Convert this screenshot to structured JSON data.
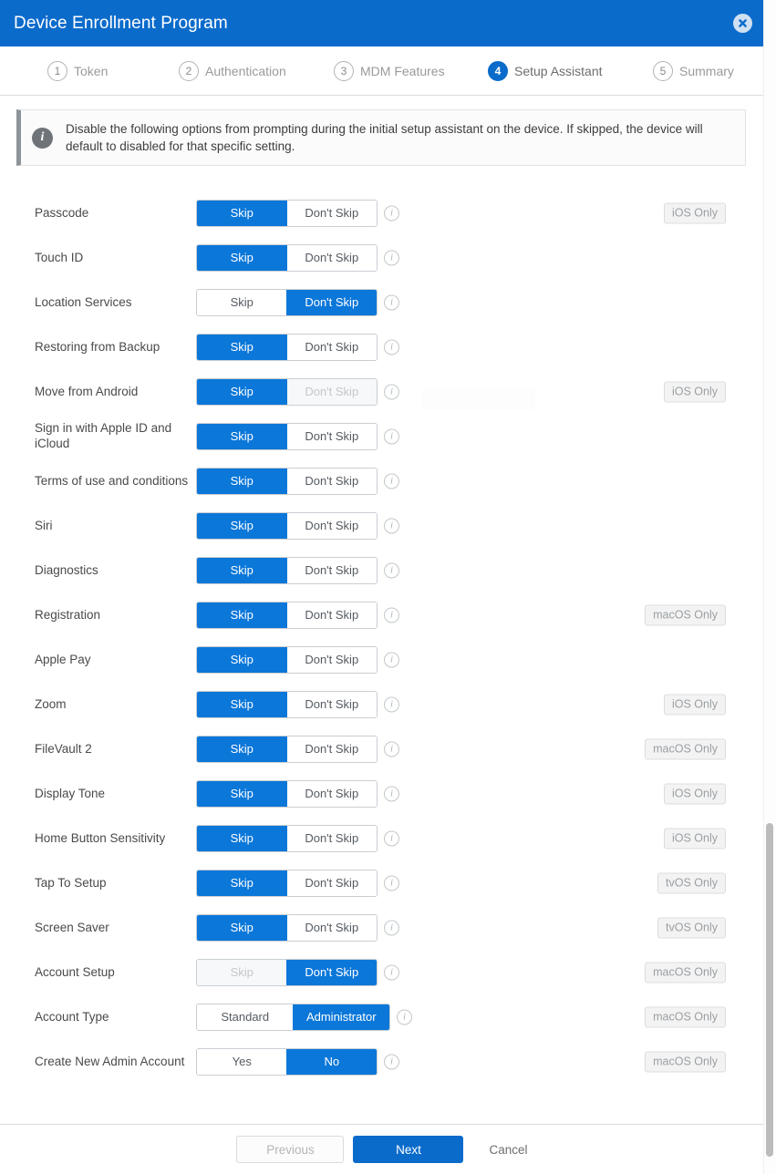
{
  "window": {
    "title": "Device Enrollment Program",
    "close_icon": "close-circle-icon",
    "accent_color": "#0b6bcb"
  },
  "stepper": {
    "steps": [
      {
        "number": "1",
        "label": "Token",
        "active": false
      },
      {
        "number": "2",
        "label": "Authentication",
        "active": false
      },
      {
        "number": "3",
        "label": "MDM Features",
        "active": false
      },
      {
        "number": "4",
        "label": "Setup Assistant",
        "active": true
      },
      {
        "number": "5",
        "label": "Summary",
        "active": false
      }
    ]
  },
  "banner": {
    "icon": "info-icon",
    "text": "Disable the following options from prompting during the initial setup assistant on the device. If skipped, the device will default to disabled for that specific setting."
  },
  "options": [
    {
      "label": "Passcode",
      "left": "Skip",
      "right": "Don't Skip",
      "selected": "left",
      "disabled": "",
      "badge": "iOS Only"
    },
    {
      "label": "Touch ID",
      "left": "Skip",
      "right": "Don't Skip",
      "selected": "left",
      "disabled": "",
      "badge": ""
    },
    {
      "label": "Location Services",
      "left": "Skip",
      "right": "Don't Skip",
      "selected": "right",
      "disabled": "",
      "badge": ""
    },
    {
      "label": "Restoring from Backup",
      "left": "Skip",
      "right": "Don't Skip",
      "selected": "left",
      "disabled": "",
      "badge": ""
    },
    {
      "label": "Move from Android",
      "left": "Skip",
      "right": "Don't Skip",
      "selected": "left",
      "disabled": "right",
      "badge": "iOS Only"
    },
    {
      "label": "Sign in with Apple ID and iCloud",
      "left": "Skip",
      "right": "Don't Skip",
      "selected": "left",
      "disabled": "",
      "badge": ""
    },
    {
      "label": "Terms of use and conditions",
      "left": "Skip",
      "right": "Don't Skip",
      "selected": "left",
      "disabled": "",
      "badge": ""
    },
    {
      "label": "Siri",
      "left": "Skip",
      "right": "Don't Skip",
      "selected": "left",
      "disabled": "",
      "badge": ""
    },
    {
      "label": "Diagnostics",
      "left": "Skip",
      "right": "Don't Skip",
      "selected": "left",
      "disabled": "",
      "badge": ""
    },
    {
      "label": "Registration",
      "left": "Skip",
      "right": "Don't Skip",
      "selected": "left",
      "disabled": "",
      "badge": "macOS Only"
    },
    {
      "label": "Apple Pay",
      "left": "Skip",
      "right": "Don't Skip",
      "selected": "left",
      "disabled": "",
      "badge": ""
    },
    {
      "label": "Zoom",
      "left": "Skip",
      "right": "Don't Skip",
      "selected": "left",
      "disabled": "",
      "badge": "iOS Only"
    },
    {
      "label": "FileVault 2",
      "left": "Skip",
      "right": "Don't Skip",
      "selected": "left",
      "disabled": "",
      "badge": "macOS Only"
    },
    {
      "label": "Display Tone",
      "left": "Skip",
      "right": "Don't Skip",
      "selected": "left",
      "disabled": "",
      "badge": "iOS Only"
    },
    {
      "label": "Home Button Sensitivity",
      "left": "Skip",
      "right": "Don't Skip",
      "selected": "left",
      "disabled": "",
      "badge": "iOS Only"
    },
    {
      "label": "Tap To Setup",
      "left": "Skip",
      "right": "Don't Skip",
      "selected": "left",
      "disabled": "",
      "badge": "tvOS Only"
    },
    {
      "label": "Screen Saver",
      "left": "Skip",
      "right": "Don't Skip",
      "selected": "left",
      "disabled": "",
      "badge": "tvOS Only"
    },
    {
      "label": "Account Setup",
      "left": "Skip",
      "right": "Don't Skip",
      "selected": "right",
      "disabled": "left",
      "badge": "macOS Only"
    },
    {
      "label": "Account Type",
      "left": "Standard",
      "right": "Administrator",
      "selected": "right",
      "disabled": "",
      "badge": "macOS Only",
      "wide": true
    },
    {
      "label": "Create New Admin Account",
      "left": "Yes",
      "right": "No",
      "selected": "right",
      "disabled": "",
      "badge": "macOS Only"
    }
  ],
  "footer": {
    "previous_label": "Previous",
    "next_label": "Next",
    "cancel_label": "Cancel"
  }
}
